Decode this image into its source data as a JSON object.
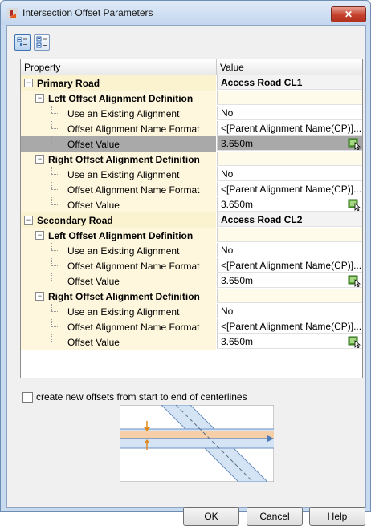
{
  "window": {
    "title": "Intersection Offset Parameters",
    "close_label": "✕"
  },
  "toolbar": {
    "buttons": [
      {
        "name": "categorized-view-icon",
        "active": true
      },
      {
        "name": "alphabetical-view-icon",
        "active": false
      }
    ]
  },
  "grid": {
    "columns": {
      "property": "Property",
      "value": "Value"
    },
    "rows": [
      {
        "level": 0,
        "label": "Primary Road",
        "value": "Access Road CL1",
        "bold": true,
        "toggle": "minus",
        "kind": "section"
      },
      {
        "level": 1,
        "label": "Left Offset Alignment Definition",
        "value": "",
        "bold": true,
        "toggle": "minus",
        "kind": "group"
      },
      {
        "level": 2,
        "label": "Use an Existing Alignment",
        "value": "No",
        "kind": "prop"
      },
      {
        "level": 2,
        "label": "Offset Alignment Name Format",
        "value": "<[Parent Alignment Name(CP)]...",
        "kind": "prop"
      },
      {
        "level": 2,
        "label": "Offset Value",
        "value": "3.650m",
        "kind": "prop",
        "pick": true,
        "selected": true
      },
      {
        "level": 1,
        "label": "Right Offset Alignment Definition",
        "value": "",
        "bold": true,
        "toggle": "minus",
        "kind": "group"
      },
      {
        "level": 2,
        "label": "Use an Existing Alignment",
        "value": "No",
        "kind": "prop"
      },
      {
        "level": 2,
        "label": "Offset Alignment Name Format",
        "value": "<[Parent Alignment Name(CP)]...",
        "kind": "prop"
      },
      {
        "level": 2,
        "label": "Offset Value",
        "value": "3.650m",
        "kind": "prop",
        "pick": true
      },
      {
        "level": 0,
        "label": "Secondary Road",
        "value": "Access Road CL2",
        "bold": true,
        "toggle": "minus",
        "kind": "section"
      },
      {
        "level": 1,
        "label": "Left Offset Alignment Definition",
        "value": "",
        "bold": true,
        "toggle": "minus",
        "kind": "group"
      },
      {
        "level": 2,
        "label": "Use an Existing Alignment",
        "value": "No",
        "kind": "prop"
      },
      {
        "level": 2,
        "label": "Offset Alignment Name Format",
        "value": "<[Parent Alignment Name(CP)]...",
        "kind": "prop"
      },
      {
        "level": 2,
        "label": "Offset Value",
        "value": "3.650m",
        "kind": "prop",
        "pick": true
      },
      {
        "level": 1,
        "label": "Right Offset Alignment Definition",
        "value": "",
        "bold": true,
        "toggle": "minus",
        "kind": "group"
      },
      {
        "level": 2,
        "label": "Use an Existing Alignment",
        "value": "No",
        "kind": "prop"
      },
      {
        "level": 2,
        "label": "Offset Alignment Name Format",
        "value": "<[Parent Alignment Name(CP)]...",
        "kind": "prop"
      },
      {
        "level": 2,
        "label": "Offset Value",
        "value": "3.650m",
        "kind": "prop",
        "pick": true
      }
    ]
  },
  "options": {
    "create_offsets_label": "create new offsets from start to end of centerlines",
    "create_offsets_checked": false
  },
  "buttons": {
    "ok": "OK",
    "cancel": "Cancel",
    "help": "Help"
  },
  "colors": {
    "selected_row": "#a9a9a9",
    "property_bg": "#fff7dd",
    "titlebar": "#c3d6ee",
    "close_button": "#c4402c"
  }
}
